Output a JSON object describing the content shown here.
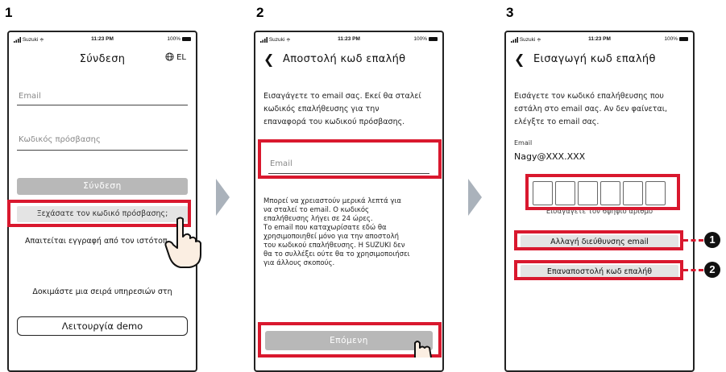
{
  "steps": [
    "1",
    "2",
    "3"
  ],
  "colors": {
    "highlight": "#d9182e",
    "disabled_button": "#b8b8b8",
    "arrow": "#aab2bb"
  },
  "status_bar": {
    "carrier": "Suzuki",
    "time": "11:23 PM",
    "battery": "100%"
  },
  "screen1": {
    "title": "Σύνδεση",
    "language": "EL",
    "email_placeholder": "Email",
    "password_placeholder": "Κωδικός πρόσβασης",
    "login_button": "Σύνδεση",
    "forgot_password_link": "Ξεχάσατε τον κωδικό πρόσβασης;",
    "registration_text": "Απαιτείται εγγραφή από τον ιστότοπ",
    "try_text": "Δοκιμάστε μια σειρά υπηρεσιών στη",
    "demo_button": "Λειτουργία demo"
  },
  "screen2": {
    "title": "Αποστολή κωδ επαλήθ",
    "instructions": [
      "Εισαγάγετε το email σας. Εκεί θα σταλεί",
      "κωδικός επαλήθευσης για την",
      "επαναφορά του κωδικού πρόσβασης."
    ],
    "email_placeholder": "Email",
    "note": [
      "Μπορεί να χρειαστούν μερικά λεπτά για",
      "να σταλεί το email. Ο κωδικός",
      "επαλήθευσης λήγει σε 24 ώρες.",
      "Το email που καταχωρίσατε εδώ θα",
      "χρησιμοποιηθεί μόνο για την αποστολή",
      "του κωδικού επαλήθευσης. Η SUZUKI δεν",
      "θα το συλλέξει ούτε θα το χρησιμοποιήσει",
      "για άλλους σκοπούς."
    ],
    "next_button": "Επόμενη"
  },
  "screen3": {
    "title": "Εισαγωγή κωδ επαλήθ",
    "instructions": [
      "Εισάγετε τον κωδικό επαλήθευσης που",
      "εστάλη στο email σας. Αν δεν φαίνεται,",
      "ελέγξτε το email σας."
    ],
    "email_label": "Email",
    "email_value": "Nagy@XXX.XXX",
    "code_hint": "Εισαγάγετε τον 6ψήφιο αριθμό",
    "change_email_button": "Αλλαγή διεύθυνσης email",
    "resend_button": "Επαναποστολή κωδ επαλήθ",
    "callouts": [
      "1",
      "2"
    ]
  },
  "icons": {
    "globe": "globe-icon",
    "back": "back-arrow-icon",
    "hand": "pointing-hand-icon",
    "signal": "signal-icon",
    "wifi": "wifi-icon",
    "battery": "battery-icon"
  }
}
